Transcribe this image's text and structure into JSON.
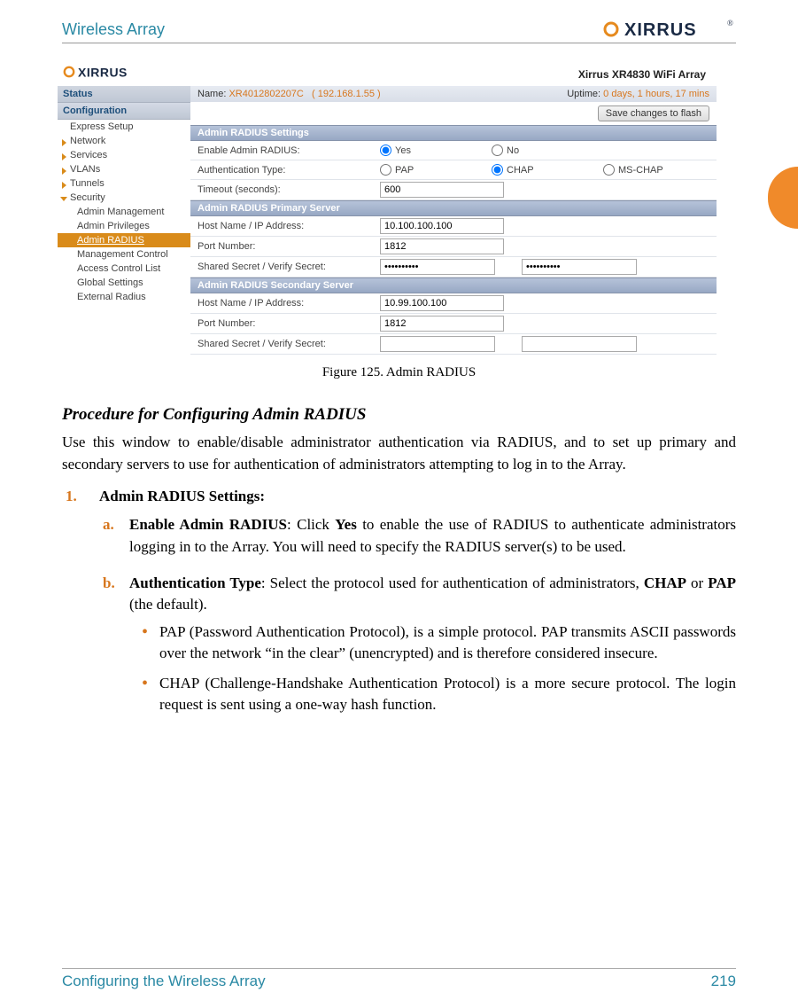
{
  "header": {
    "title": "Wireless Array"
  },
  "brand": "XIRRUS",
  "ui": {
    "brand": "XIRRUS",
    "product_title": "Xirrus XR4830 WiFi Array",
    "info": {
      "name_label": "Name:",
      "name_value": "XR4012802207C",
      "ip_value": "( 192.168.1.55 )",
      "uptime_label": "Uptime:",
      "uptime_value": "0 days, 1 hours, 17 mins"
    },
    "save_button": "Save changes to flash",
    "sidebar": {
      "status": "Status",
      "config": "Configuration",
      "items": [
        "Express Setup",
        "Network",
        "Services",
        "VLANs",
        "Tunnels",
        "Security"
      ],
      "subitems": [
        "Admin Management",
        "Admin Privileges",
        "Admin RADIUS",
        "Management Control",
        "Access Control List",
        "Global Settings",
        "External Radius"
      ]
    },
    "sections": {
      "s1": "Admin RADIUS Settings",
      "s2": "Admin RADIUS Primary Server",
      "s3": "Admin RADIUS Secondary Server"
    },
    "rows": {
      "enable_label": "Enable Admin RADIUS:",
      "yes": "Yes",
      "no": "No",
      "auth_label": "Authentication Type:",
      "pap": "PAP",
      "chap": "CHAP",
      "mschap": "MS-CHAP",
      "timeout_label": "Timeout (seconds):",
      "timeout_value": "600",
      "host_label": "Host Name / IP Address:",
      "port_label": "Port Number:",
      "secret_label": "Shared Secret / Verify Secret:",
      "primary_host": "10.100.100.100",
      "primary_port": "1812",
      "primary_secret": "••••••••••",
      "secondary_host": "10.99.100.100",
      "secondary_port": "1812",
      "secondary_secret": ""
    }
  },
  "caption": "Figure 125. Admin RADIUS",
  "proc_heading": "Procedure for Configuring Admin RADIUS",
  "intro": "Use this window to enable/disable administrator authentication via RADIUS, and to set up primary and secondary servers to use for authentication of administrators attempting to log in to the Array.",
  "list": {
    "n1": "1.",
    "t1": "Admin RADIUS Settings:",
    "a_letter": "a.",
    "a_bold": "Enable Admin RADIUS",
    "a_rest": ": Click ",
    "a_yes": "Yes",
    "a_rest2": " to enable the use of RADIUS to authenticate administrators logging in to the Array. You will need to specify the RADIUS server(s) to be used.",
    "b_letter": "b.",
    "b_bold": "Authentication Type",
    "b_rest": ": Select the protocol used for authentication of administrators, ",
    "b_chap": "CHAP",
    "b_or": " or ",
    "b_pap": "PAP",
    "b_rest2": " (the default).",
    "bul1": "PAP (Password Authentication Protocol), is a simple protocol. PAP transmits ASCII passwords over the network “in the clear” (unencrypted) and is therefore considered insecure.",
    "bul2": "CHAP (Challenge-Handshake Authentication Protocol) is a more secure protocol. The login request is sent using a one-way hash function."
  },
  "footer": {
    "left": "Configuring the Wireless Array",
    "right": "219"
  }
}
